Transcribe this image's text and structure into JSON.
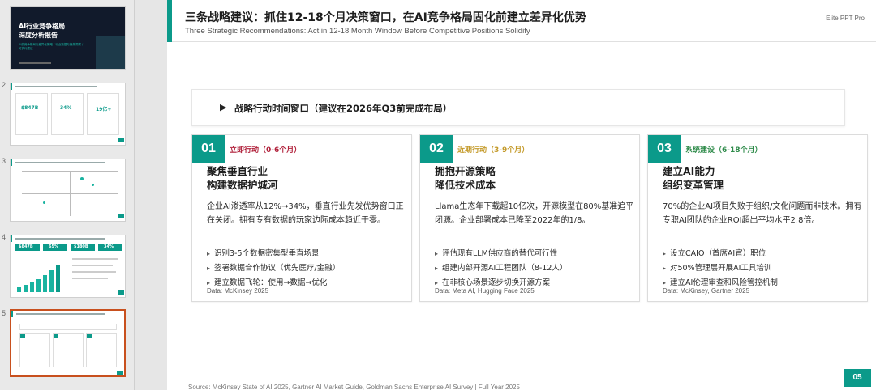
{
  "thumbnails": [
    {
      "index": "",
      "title_lines": [
        "AI行业竞争格局",
        "深度分析报告"
      ],
      "subtitle": "AI的竞争格局与差异化策略 / 行业数据与趋势洞察 / 可执行建议"
    },
    {
      "index": "2",
      "kpis": [
        "$847B",
        "34%",
        "19亿+"
      ]
    },
    {
      "index": "3"
    },
    {
      "index": "4",
      "kpis": [
        "$847B",
        "65%",
        "$180B",
        "34%"
      ]
    },
    {
      "index": "5"
    }
  ],
  "slide": {
    "title_cn": "三条战略建议：抓住12-18个月决策窗口，在AI竞争格局固化前建立差异化优势",
    "title_en": "Three Strategic Recommendations: Act in 12-18 Month Window Before Competitive Positions Solidify",
    "brand": "Elite PPT Pro",
    "banner_arrow": "▶",
    "banner_text": "战略行动时间窗口（建议在2026年Q3前完成布局）",
    "bullet_icon": "▸",
    "cards": [
      {
        "num": "01",
        "phase": "立即行动（0-6个月）",
        "phase_color": "#b0203a",
        "title_lines": [
          "聚焦垂直行业",
          "构建数据护城河"
        ],
        "desc": "企业AI渗透率从12%→34%，垂直行业先发优势窗口正在关闭。拥有专有数据的玩家边际成本趋近于零。",
        "bullets": [
          "识别3-5个数据密集型垂直场景",
          "签署数据合作协议（优先医疗/金融）",
          "建立数据飞轮：使用→数据→优化"
        ],
        "source": "Data: McKinsey 2025"
      },
      {
        "num": "02",
        "phase": "近期行动（3-9个月）",
        "phase_color": "#c49a2a",
        "title_lines": [
          "拥抱开源策略",
          "降低技术成本"
        ],
        "desc": "Llama生态年下载超10亿次，开源模型在80%基准追平闭源。企业部署成本已降至2022年的1/8。",
        "bullets": [
          "评估现有LLM供应商的替代可行性",
          "组建内部开源AI工程团队（8-12人）",
          "在非核心场景逐步切换开源方案"
        ],
        "source": "Data: Meta AI, Hugging Face 2025"
      },
      {
        "num": "03",
        "phase": "系统建设（6-18个月）",
        "phase_color": "#2e8b4a",
        "title_lines": [
          "建立AI能力",
          "组织变革管理"
        ],
        "desc": "70%的企业AI项目失败于组织/文化问题而非技术。拥有专职AI团队的企业ROI超出平均水平2.8倍。",
        "bullets": [
          "设立CAIO（首席AI官）职位",
          "对50%管理层开展AI工具培训",
          "建立AI伦理审查和风险管控机制"
        ],
        "source": "Data: McKinsey, Gartner 2025"
      }
    ],
    "page_number": "05",
    "footnote": "Source: McKinsey State of AI 2025, Gartner AI Market Guide, Goldman Sachs Enterprise AI Survey | Full Year 2025"
  },
  "colors": {
    "accent": "#0b9a8a",
    "selected_border": "#c8501e"
  }
}
